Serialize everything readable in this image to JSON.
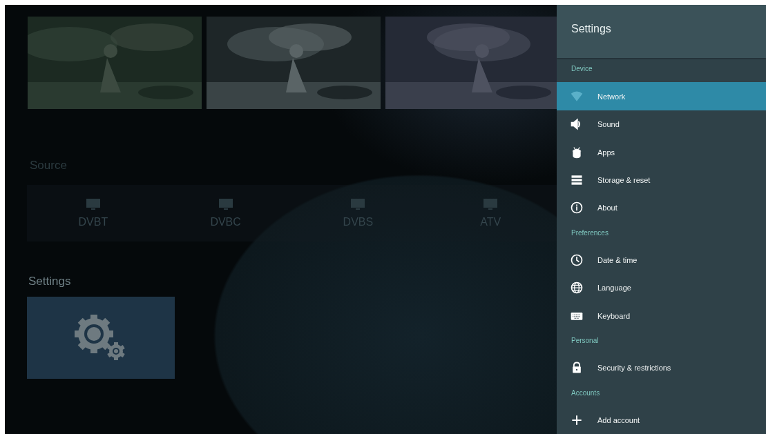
{
  "home": {
    "source": {
      "title": "Source",
      "items": [
        {
          "label": "DVBT"
        },
        {
          "label": "DVBC"
        },
        {
          "label": "DVBS"
        },
        {
          "label": "ATV"
        }
      ]
    },
    "settings": {
      "title": "Settings"
    }
  },
  "panel": {
    "title": "Settings",
    "sections": [
      {
        "header": "Device",
        "items": [
          {
            "label": "Network",
            "selected": true
          },
          {
            "label": "Sound",
            "selected": false
          },
          {
            "label": "Apps",
            "selected": false
          },
          {
            "label": "Storage & reset",
            "selected": false
          },
          {
            "label": "About",
            "selected": false
          }
        ]
      },
      {
        "header": "Preferences",
        "items": [
          {
            "label": "Date & time",
            "selected": false
          },
          {
            "label": "Language",
            "selected": false
          },
          {
            "label": "Keyboard",
            "selected": false
          }
        ]
      },
      {
        "header": "Personal",
        "items": [
          {
            "label": "Security & restrictions",
            "selected": false
          }
        ]
      },
      {
        "header": "Accounts",
        "items": [
          {
            "label": "Add account",
            "selected": false
          }
        ]
      }
    ]
  }
}
